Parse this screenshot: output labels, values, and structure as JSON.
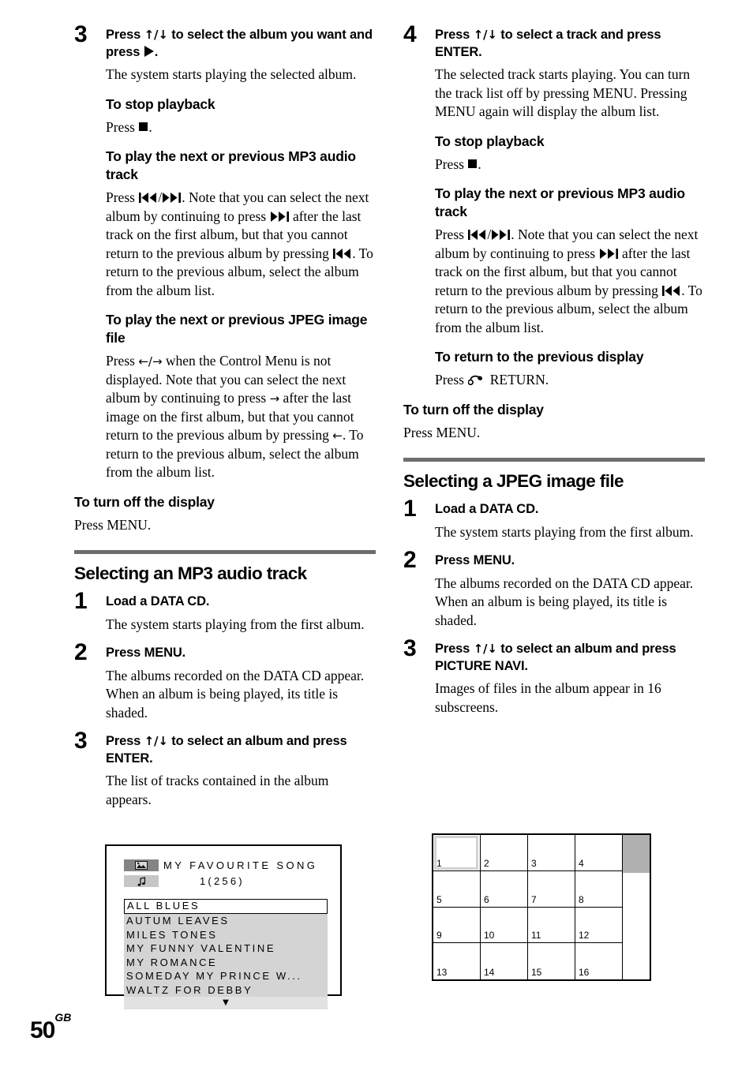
{
  "page": {
    "number": "50",
    "region_suffix": "GB"
  },
  "left_column": {
    "step3": {
      "number": "3",
      "title_before": "Press ",
      "title_arrows": "↑/↓",
      "title_mid": " to select the album you want and press ",
      "title_after": ".",
      "body": "The system starts playing the selected album."
    },
    "stop_playback": {
      "heading": "To stop playback",
      "press_label": "Press ",
      "period": "."
    },
    "mp3_track": {
      "heading": "To play the next or previous MP3 audio track",
      "press_label": "Press ",
      "slash": "/",
      "body_1": ". Note that you can select the next album by continuing to press ",
      "body_2": " after the last track on the first album, but that you cannot return to the previous album by pressing ",
      "body_3": ". To return to the previous album, select the album from the album list."
    },
    "jpeg_file": {
      "heading": "To play the next or previous JPEG image file",
      "press_label": "Press ",
      "arrows": "←/→",
      "body_1": " when the Control Menu is not displayed. Note that you can select the next album by continuing to press ",
      "arrow_right": "→",
      "body_2": " after the last image on the first album, but that you cannot return to the previous album by pressing ",
      "arrow_left": "←",
      "body_3": ". To return to the previous album, select the album from the album list."
    },
    "turn_off_display": {
      "heading": "To turn off the display",
      "body": "Press MENU."
    },
    "section": {
      "title": "Selecting an MP3 audio track",
      "step1": {
        "number": "1",
        "title": "Load a DATA CD.",
        "body": "The system starts playing from the first album."
      },
      "step2": {
        "number": "2",
        "title": "Press MENU.",
        "body": "The albums recorded on the DATA CD appear. When an album is being played, its title is shaded."
      },
      "step3": {
        "number": "3",
        "title_before": "Press ",
        "title_arrows": "↑/↓",
        "title_after": " to select an album and press ENTER.",
        "body": "The list of tracks contained in the album appears."
      }
    }
  },
  "right_column": {
    "step4": {
      "number": "4",
      "title_before": "Press ",
      "title_arrows": "↑/↓",
      "title_after": " to select a track and press ENTER.",
      "body": "The selected track starts playing. You can turn the track list off by pressing MENU. Pressing MENU again will display the album list."
    },
    "stop_playback": {
      "heading": "To stop playback",
      "press_label": "Press ",
      "period": "."
    },
    "mp3_track": {
      "heading": "To play the next or previous MP3 audio track",
      "press_label": "Press ",
      "slash": "/",
      "body_1": ". Note that you can select the next album by continuing to press ",
      "body_2": " after the last track on the first album, but that you cannot return to the previous album by pressing ",
      "body_3": ". To return to the previous album, select the album from the album list."
    },
    "return_previous": {
      "heading": "To return to the previous display",
      "press_label": "Press ",
      "return_label": " RETURN."
    },
    "turn_off_display": {
      "heading": "To turn off the display",
      "body": "Press MENU."
    },
    "section": {
      "title": "Selecting a JPEG image file",
      "step1": {
        "number": "1",
        "title": "Load a DATA CD.",
        "body": "The system starts playing from the first album."
      },
      "step2": {
        "number": "2",
        "title": "Press MENU.",
        "body": "The albums recorded on the DATA CD appear. When an album is being played, its title is shaded."
      },
      "step3": {
        "number": "3",
        "title_before": "Press ",
        "title_arrows": "↑/↓",
        "title_after": " to select an album and press PICTURE NAVI.",
        "body": "Images of files in the album appear in 16 subscreens."
      }
    }
  },
  "track_list_screen": {
    "album_title": "MY FAVOURITE SONG",
    "track_count": "1(256)",
    "tracks": [
      "ALL BLUES",
      "AUTUM LEAVES",
      "MILES TONES",
      "MY FUNNY VALENTINE",
      "MY ROMANCE",
      "SOMEDAY MY PRINCE W...",
      "WALTZ FOR DEBBY"
    ],
    "selected_index": 0,
    "more_indicator": "▼"
  },
  "grid_screen": {
    "cells": [
      "1",
      "2",
      "3",
      "4",
      "5",
      "6",
      "7",
      "8",
      "9",
      "10",
      "11",
      "12",
      "13",
      "14",
      "15",
      "16"
    ],
    "selected_index": 0
  },
  "colors": {
    "rule": "#6d6d6d",
    "list_panel": "#d4d4d4",
    "badge_dark": "#848484",
    "badge_light": "#c6c6c6",
    "scroll_thumb": "#b0b0b0",
    "selection_border": "#d2d2d2"
  }
}
